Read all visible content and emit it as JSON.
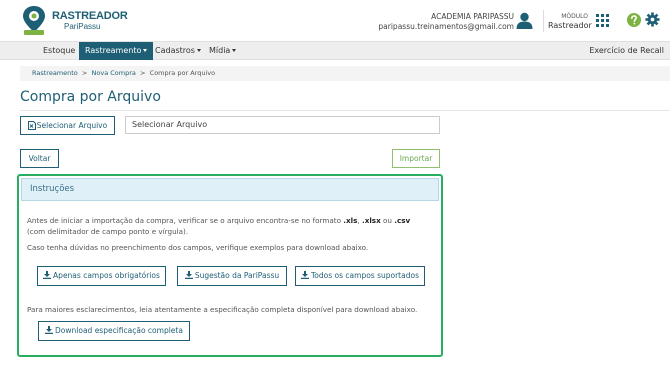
{
  "header": {
    "logo_title": "RASTREADOR",
    "logo_sub": "PariPassu",
    "account_name": "ACADEMIA PARIPASSU",
    "account_email": "paripassu.treinamentos@gmail.com",
    "module_label": "MÓDULO",
    "module_name": "Rastreador",
    "brand_color": "#1f5f75",
    "help_color": "#7cb342"
  },
  "nav": {
    "items": [
      {
        "label": "Estoque",
        "caret": false
      },
      {
        "label": "Rastreamento",
        "caret": true,
        "active": true
      },
      {
        "label": "Cadastros",
        "caret": true
      },
      {
        "label": "Mídia",
        "caret": true
      }
    ],
    "right_label": "Exercício de Recall"
  },
  "breadcrumb": [
    "Rastreamento",
    "Nova Compra",
    "Compra por Arquivo"
  ],
  "page": {
    "title": "Compra por Arquivo",
    "select_button": "Selecionar Arquivo",
    "file_input_value": "Selecionar Arquivo",
    "back_button": "Voltar",
    "import_button": "Importar"
  },
  "instructions": {
    "heading": "Instruções",
    "intro_pre": "Antes de iniciar a importação da compra, verificar se o arquivo encontra-se no formato ",
    "fmt1": ".xls",
    "sep1": ", ",
    "fmt2": ".xlsx",
    "sep2": " ou ",
    "fmt3": ".csv",
    "intro_line2": "(com delimitador de campo ponto e vírgula).",
    "doubt_text": "Caso tenha dúvidas no preenchimento dos campos, verifique exemplos para download abaixo.",
    "btn_required": "Apenas campos obrigatórios",
    "btn_suggestion": "Sugestão da PariPassu",
    "btn_all": "Todos os campos suportados",
    "more_text": "Para maiores esclarecimentos, leia atentamente a especificação completa disponível para download abaixo.",
    "btn_spec": "Download especificação completa",
    "panel_border_color": "#27ae60"
  }
}
